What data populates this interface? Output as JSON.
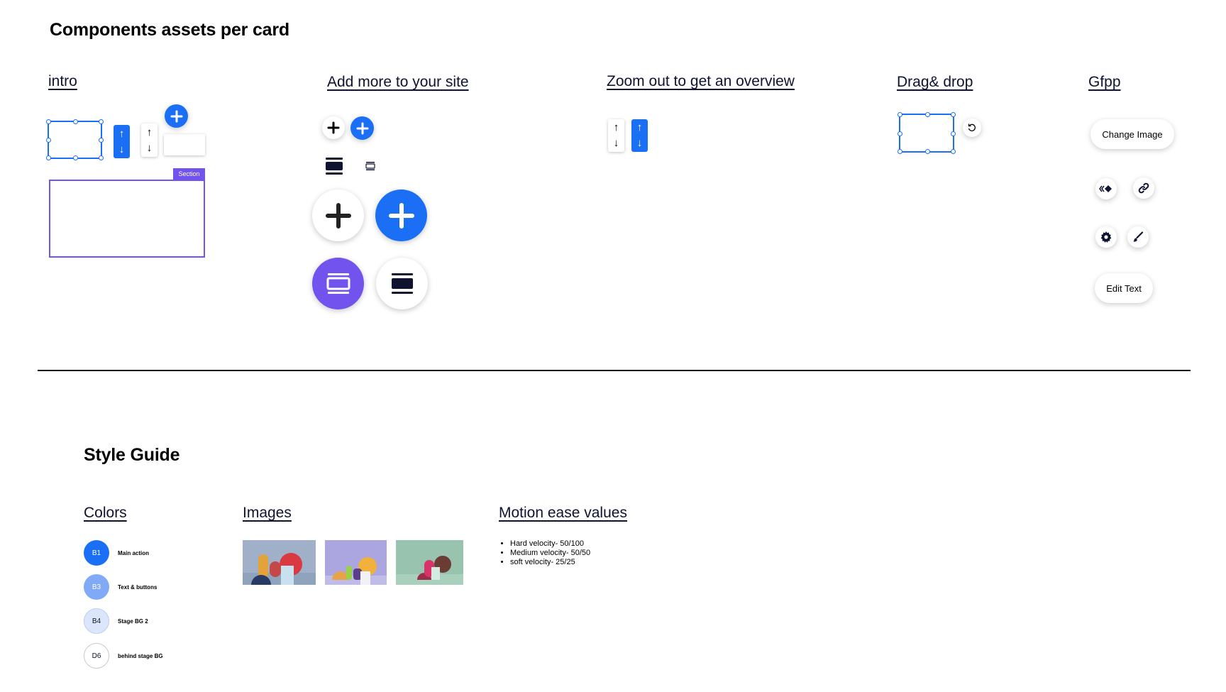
{
  "page": {
    "title": "Components assets per card",
    "style_guide_title": "Style Guide"
  },
  "cards": {
    "intro": {
      "title": "intro",
      "section_tag": "Section"
    },
    "add_more": {
      "title": "Add more to your site"
    },
    "zoom_out": {
      "title": "Zoom out to get an overview"
    },
    "drag_drop": {
      "title": "Drag& drop"
    },
    "gfpp": {
      "title": "Gfpp",
      "change_image": "Change Image",
      "edit_text": "Edit Text"
    }
  },
  "style_guide": {
    "colors_title": "Colors",
    "images_title": "Images",
    "motion_title": "Motion ease values",
    "colors": [
      {
        "code": "B1",
        "label": "Main action",
        "hex": "#1a6ff5",
        "text_color": "#ffffff"
      },
      {
        "code": "B3",
        "label": "Text & buttons",
        "hex": "#80aaf5",
        "text_color": "#ffffff"
      },
      {
        "code": "B4",
        "label": "Stage BG 2",
        "hex": "#dbe6fb",
        "text_color": "#0e1330"
      },
      {
        "code": "D6",
        "label": "behind stage BG",
        "hex": "#ffffff",
        "text_color": "#0e1330"
      }
    ],
    "motion_values": [
      "Hard velocity- 50/100",
      "Medium velocity- 50/50",
      "soft velocity- 25/25"
    ]
  },
  "colors": {
    "accent_blue": "#1a6ff5",
    "accent_purple": "#7353ed",
    "ink": "#0e1330"
  },
  "icons": {
    "arrows": {
      "up": "↑",
      "down": "↓"
    },
    "names": [
      "plus-icon",
      "section-layout-icon",
      "arrow-up-icon",
      "arrow-down-icon",
      "rotate-icon",
      "animation-icon",
      "link-icon",
      "gear-icon",
      "brush-icon"
    ]
  }
}
